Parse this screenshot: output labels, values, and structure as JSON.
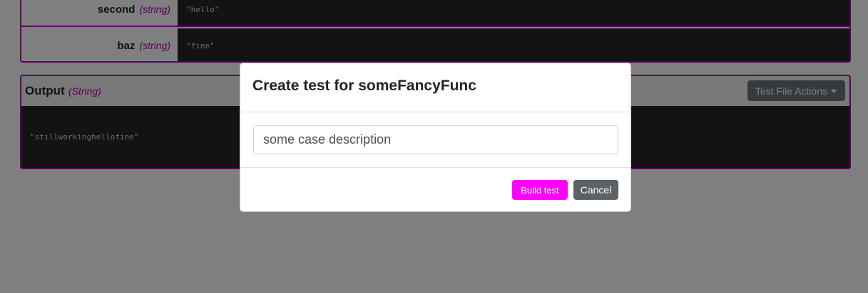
{
  "params": [
    {
      "name": "second",
      "type": "(string)",
      "value": "\"hello\""
    },
    {
      "name": "baz",
      "type": "(string)",
      "value": "\"fine\""
    }
  ],
  "output": {
    "title": "Output",
    "type": "(String)",
    "actions_label": "Test File Actions",
    "value": "\"stillworkinghellofine\""
  },
  "modal": {
    "title": "Create test for someFancyFunc",
    "input_value": "some case description",
    "build_label": "Build test",
    "cancel_label": "Cancel"
  },
  "colors": {
    "accent": "#b000b0",
    "build_button": "#ff00ff",
    "cancel_button": "#5a6268",
    "secondary_button": "#6c757d",
    "code_background": "#262626"
  }
}
